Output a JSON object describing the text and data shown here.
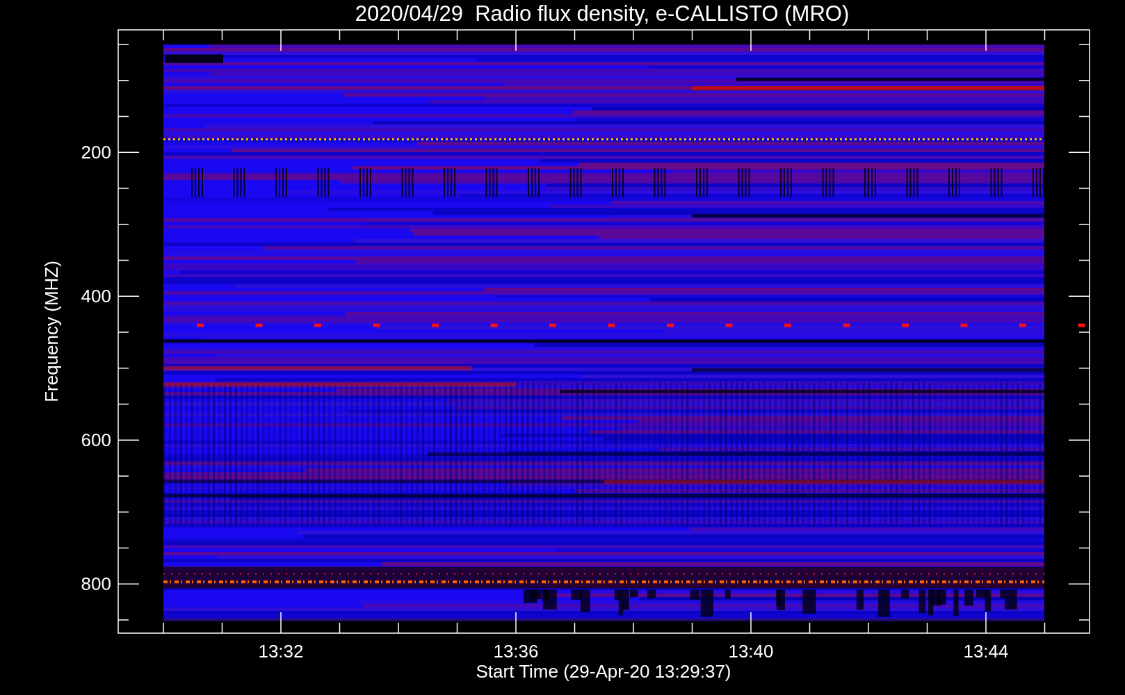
{
  "title": "2020/04/29  Radio flux density, e-CALLISTO (MRO)",
  "y_axis": {
    "label": "Frequency (MHZ)",
    "ticks": [
      "200",
      "400",
      "600",
      "800"
    ]
  },
  "x_axis": {
    "label": "Start Time (29-Apr-20 13:29:37)",
    "ticks": [
      "13:32",
      "13:36",
      "13:40",
      "13:44"
    ]
  }
}
